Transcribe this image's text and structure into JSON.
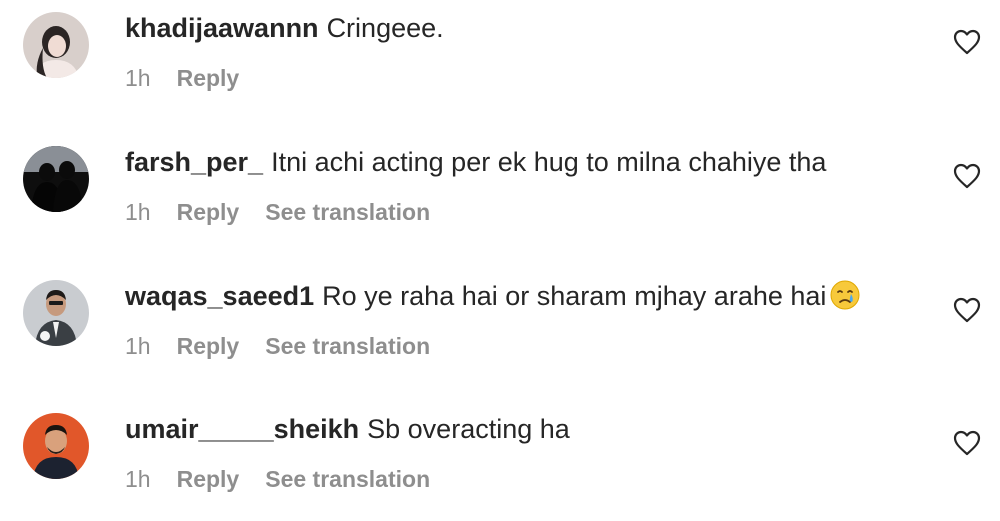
{
  "comments": [
    {
      "username": "khadijaawannn",
      "text": "Cringeee.",
      "time": "1h",
      "reply_label": "Reply",
      "translate_label": ""
    },
    {
      "username": "farsh_per_",
      "text": "Itni achi acting per ek hug to milna chahiye tha",
      "time": "1h",
      "reply_label": "Reply",
      "translate_label": "See translation"
    },
    {
      "username": "waqas_saeed1",
      "text": "Ro ye raha hai or sharam mjhay arahe hai",
      "emoji": "crying-face",
      "time": "1h",
      "reply_label": "Reply",
      "translate_label": "See translation"
    },
    {
      "username": "umair_____sheikh",
      "text": "Sb overacting ha",
      "time": "1h",
      "reply_label": "Reply",
      "translate_label": "See translation"
    }
  ],
  "colors": {
    "text": "#262626",
    "secondary": "#8e8e8e",
    "background": "#ffffff"
  }
}
